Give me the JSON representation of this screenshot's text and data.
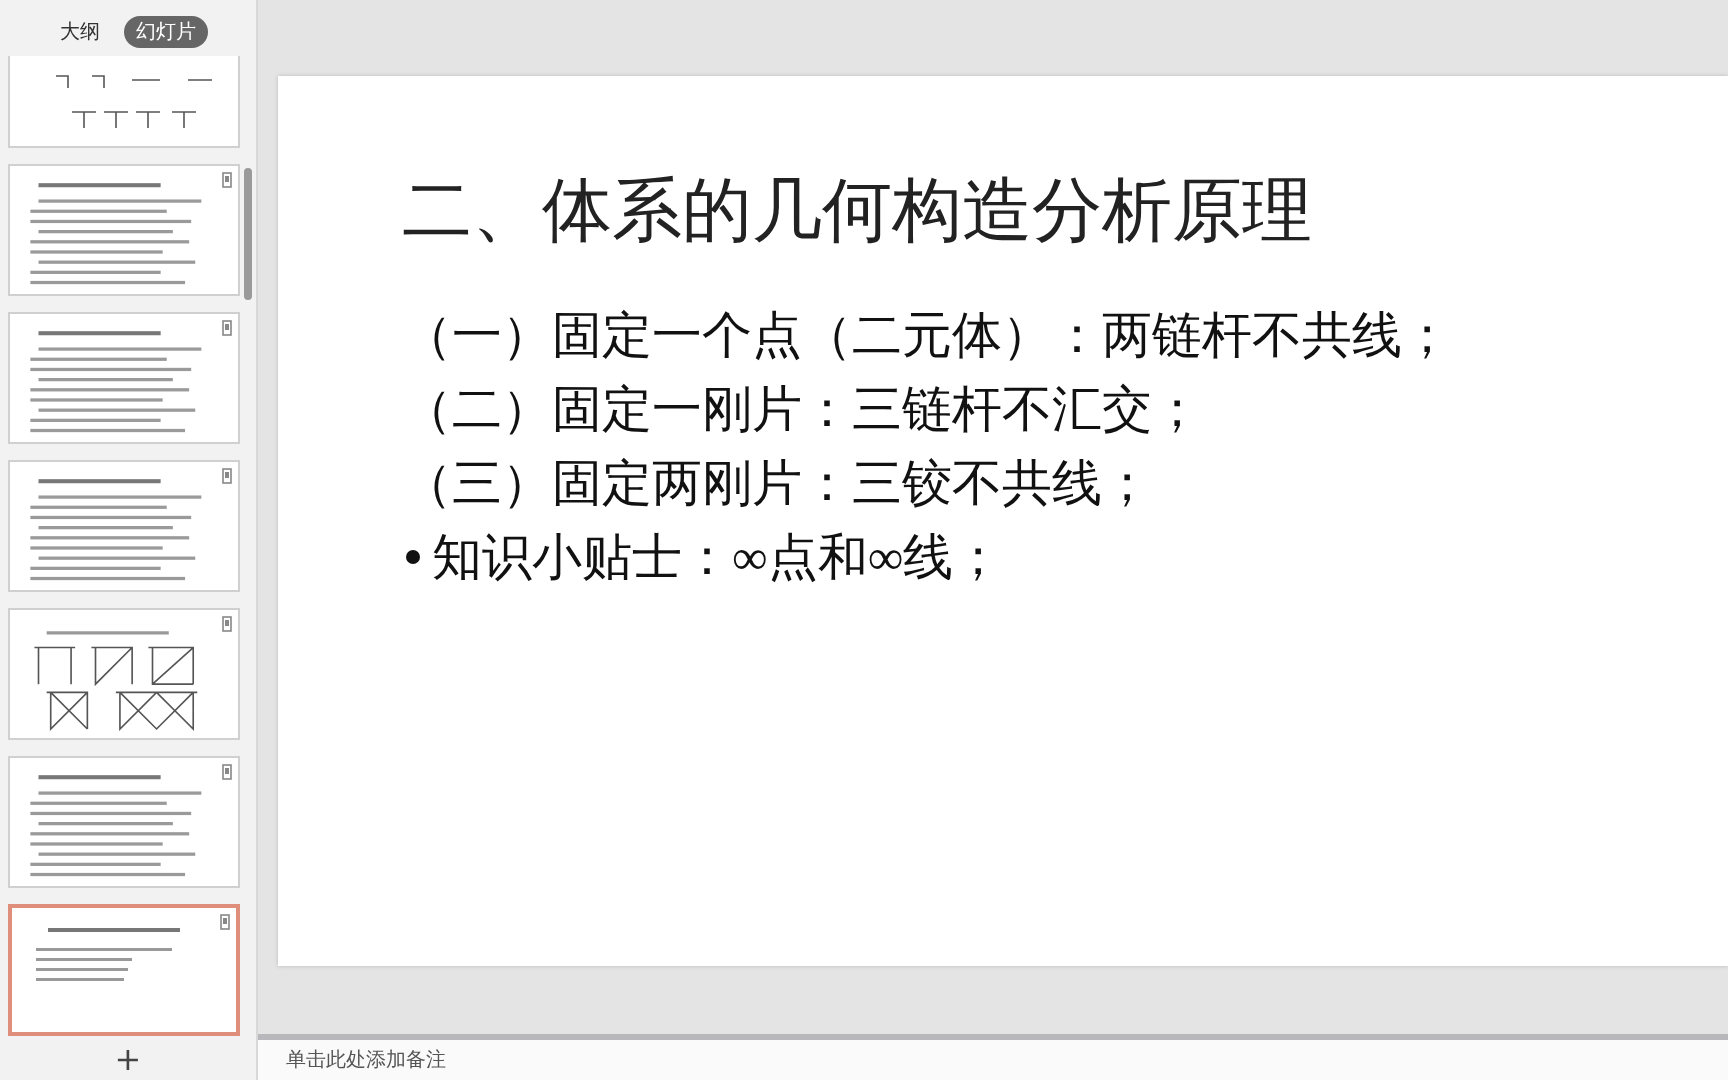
{
  "sidebar": {
    "tabs": [
      {
        "label": "大纲",
        "selected": false
      },
      {
        "label": "幻灯片",
        "selected": true
      }
    ],
    "thumbnails": [
      {
        "kind": "supports",
        "selected": false
      },
      {
        "kind": "text",
        "selected": false
      },
      {
        "kind": "text",
        "selected": false
      },
      {
        "kind": "text",
        "selected": false
      },
      {
        "kind": "frames",
        "selected": false
      },
      {
        "kind": "text",
        "selected": false
      },
      {
        "kind": "outline",
        "selected": true
      }
    ],
    "add_label": "+"
  },
  "slide": {
    "title": "二、体系的几何构造分析原理",
    "lines": [
      {
        "kind": "plain",
        "text": "（一）固定一个点（二元体）：两链杆不共线；"
      },
      {
        "kind": "plain",
        "text": "（二）固定一刚片：三链杆不汇交；"
      },
      {
        "kind": "plain",
        "text": "（三）固定两刚片：三铰不共线；"
      },
      {
        "kind": "bullet",
        "text": "知识小贴士：∞点和∞线；"
      }
    ]
  },
  "notes": {
    "placeholder": "单击此处添加备注"
  }
}
